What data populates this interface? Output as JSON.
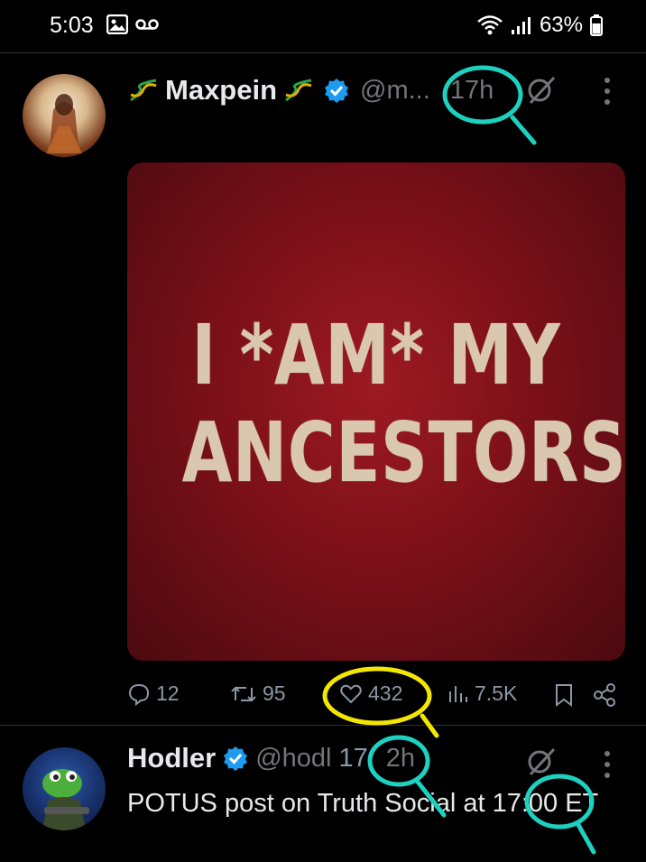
{
  "status_bar": {
    "time": "5:03",
    "battery": "63%"
  },
  "tweet1": {
    "name": "Maxpein",
    "name_decor_emoji": "dna-emoji",
    "handle": "@m...",
    "time": "17h",
    "media_text_line1": "I *AM* MY",
    "media_text_line2": "ANCESTORS.",
    "actions": {
      "replies": "12",
      "reposts": "95",
      "likes": "432",
      "views": "7.5K"
    }
  },
  "tweet2": {
    "name": "Hodler",
    "handle": "@hodl",
    "time_partial": "17",
    "time_rest": "2h",
    "text": "POTUS post on Truth Social at 17:00 ET"
  },
  "colors": {
    "verified": "#1d9bf0",
    "annotation_cyan": "#1dd1c1",
    "annotation_yellow": "#f3e600",
    "media_red": "#8c121b"
  }
}
